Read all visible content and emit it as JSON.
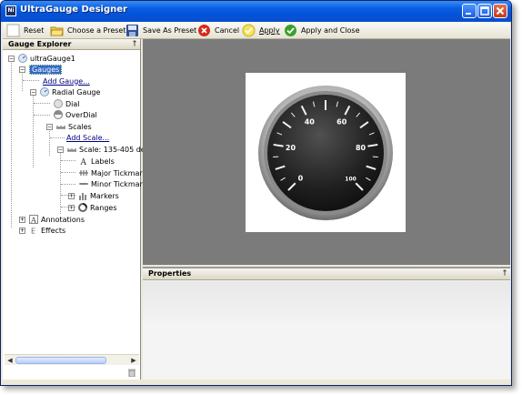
{
  "window": {
    "title": "UltraGauge Designer",
    "icon_label": "Ni"
  },
  "toolbar": {
    "reset": "Reset",
    "choose_preset": "Choose a Preset",
    "save_preset": "Save As Preset",
    "cancel": "Cancel",
    "apply": "Apply",
    "apply_close": "Apply and Close"
  },
  "explorer": {
    "title": "Gauge Explorer",
    "pin": "†",
    "nodes": {
      "root": "ultraGauge1",
      "gauges": "Gauges",
      "add_gauge": "Add Gauge...",
      "radial": "Radial Gauge",
      "dial": "Dial",
      "overdial": "OverDial",
      "scales": "Scales",
      "add_scale": "Add Scale...",
      "scale": "Scale: 135-405 de",
      "labels": "Labels",
      "major": "Major Tickmar",
      "minor": "Minor Tickmar",
      "markers": "Markers",
      "ranges": "Ranges",
      "annotations": "Annotations",
      "effects": "Effects"
    }
  },
  "gauge": {
    "labels": [
      "0",
      "20",
      "40",
      "60",
      "80",
      "100"
    ],
    "min": 0,
    "max": 100,
    "start_angle": 135,
    "end_angle": 405
  },
  "properties": {
    "title": "Properties",
    "pin": "†"
  },
  "colors": {
    "title_bar": "#0453d8",
    "selection": "#316ac5",
    "designer_bg": "#7b7b7b"
  }
}
